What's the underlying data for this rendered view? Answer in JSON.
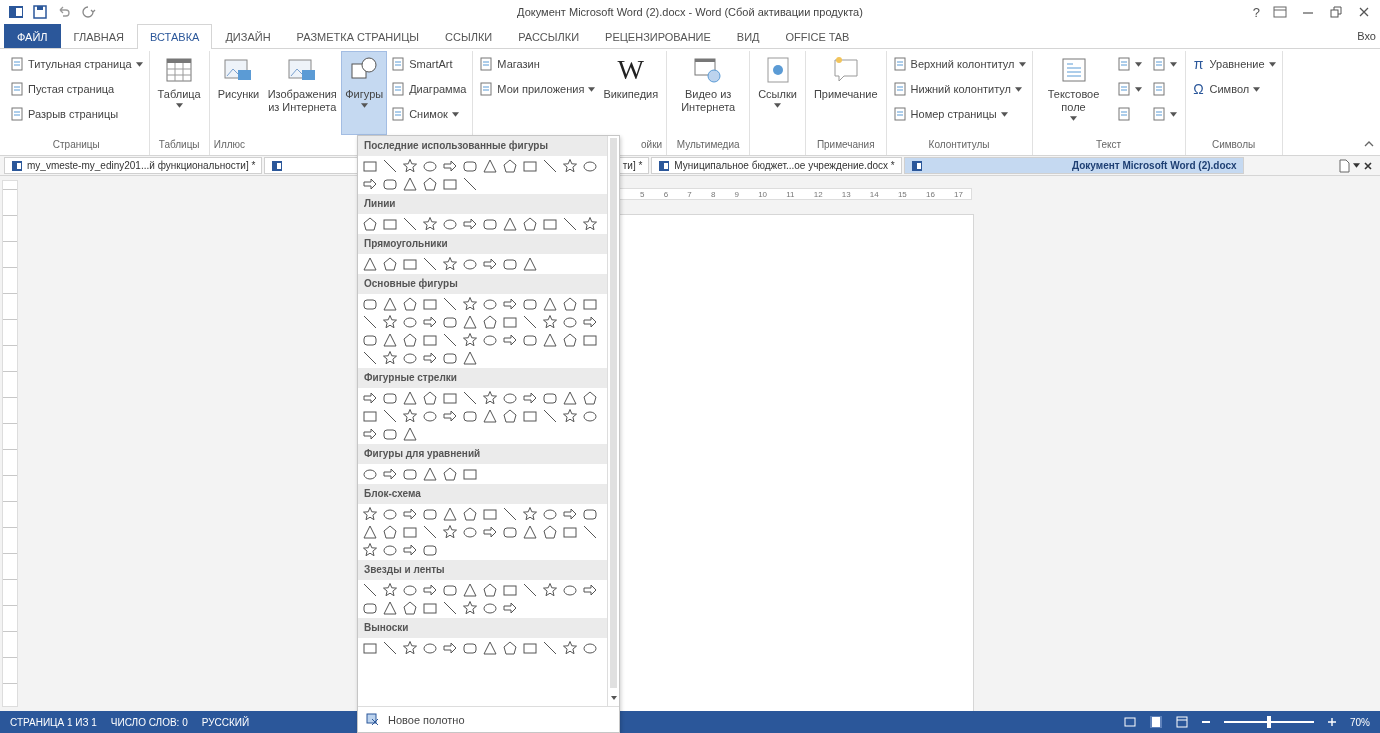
{
  "window": {
    "title": "Документ Microsoft Word (2).docx - Word (Сбой активации продукта)",
    "help": "?"
  },
  "menu_tabs": [
    {
      "label": "ФАЙЛ",
      "kind": "file",
      "selected": false
    },
    {
      "label": "ГЛАВНАЯ",
      "kind": "tab",
      "selected": false
    },
    {
      "label": "ВСТАВКА",
      "kind": "tab",
      "selected": true
    },
    {
      "label": "ДИЗАЙН",
      "kind": "tab",
      "selected": false
    },
    {
      "label": "РАЗМЕТКА СТРАНИЦЫ",
      "kind": "tab",
      "selected": false
    },
    {
      "label": "ССЫЛКИ",
      "kind": "tab",
      "selected": false
    },
    {
      "label": "РАССЫЛКИ",
      "kind": "tab",
      "selected": false
    },
    {
      "label": "РЕЦЕНЗИРОВАНИЕ",
      "kind": "tab",
      "selected": false
    },
    {
      "label": "ВИД",
      "kind": "tab",
      "selected": false
    },
    {
      "label": "OFFICE TAB",
      "kind": "tab",
      "selected": false
    }
  ],
  "sign_in": "Вхо",
  "ribbon": {
    "groups": [
      {
        "label": "Страницы",
        "items": [
          {
            "kind": "small",
            "label": "Титульная страница",
            "dropdown": true
          },
          {
            "kind": "small",
            "label": "Пустая страница"
          },
          {
            "kind": "small",
            "label": "Разрыв страницы"
          }
        ]
      },
      {
        "label": "Таблицы",
        "items": [
          {
            "kind": "large",
            "label": "Таблица",
            "dropdown": true
          }
        ]
      },
      {
        "label": "Иллюс",
        "items": [
          {
            "kind": "large",
            "label": "Рисунки"
          },
          {
            "kind": "large",
            "label": "Изображения из Интернета"
          },
          {
            "kind": "large",
            "label": "Фигуры",
            "dropdown": true,
            "pressed": true
          },
          {
            "kind": "small",
            "label": "SmartArt"
          },
          {
            "kind": "small",
            "label": "Диаграмма"
          },
          {
            "kind": "small",
            "label": "Снимок",
            "dropdown": true
          }
        ]
      },
      {
        "label": "ойки",
        "items": [
          {
            "kind": "small",
            "label": "Магазин"
          },
          {
            "kind": "small",
            "label": "Мои приложения",
            "dropdown": true
          },
          {
            "kind": "large",
            "label": "Википедия",
            "icon_text": "W"
          }
        ]
      },
      {
        "label": "Мультимедиа",
        "items": [
          {
            "kind": "large",
            "label": "Видео из Интернета"
          }
        ]
      },
      {
        "items": [
          {
            "kind": "large",
            "label": "Ссылки",
            "dropdown": true
          }
        ]
      },
      {
        "label": "Примечания",
        "items": [
          {
            "kind": "large",
            "label": "Примечание"
          }
        ]
      },
      {
        "label": "Колонтитулы",
        "items": [
          {
            "kind": "small",
            "label": "Верхний колонтитул",
            "dropdown": true
          },
          {
            "kind": "small",
            "label": "Нижний колонтитул",
            "dropdown": true
          },
          {
            "kind": "small",
            "label": "Номер страницы",
            "dropdown": true
          }
        ]
      },
      {
        "label": "Текст",
        "items": [
          {
            "kind": "large",
            "label": "Текстовое поле",
            "dropdown": true
          },
          {
            "kind": "icon",
            "dropdown": true
          },
          {
            "kind": "icon",
            "dropdown": true
          },
          {
            "kind": "icon",
            "dropdown": false
          },
          {
            "kind": "icon",
            "dropdown": true
          },
          {
            "kind": "icon",
            "dropdown": false
          },
          {
            "kind": "icon",
            "dropdown": true
          }
        ]
      },
      {
        "label": "Символы",
        "items": [
          {
            "kind": "small",
            "label": "Уравнение",
            "icon_text": "π",
            "dropdown": true
          },
          {
            "kind": "small",
            "label": "Символ",
            "icon_text": "Ω",
            "dropdown": true
          }
        ]
      }
    ]
  },
  "doc_tabs": [
    {
      "label": "my_vmeste-my_ediny201...й функциональности] *",
      "selected": false
    },
    {
      "label": "ти] *",
      "selected": false
    },
    {
      "label": "Муниципальное бюджет...ое учреждение.docx *",
      "selected": false
    },
    {
      "label": "Документ Microsoft Word (2).docx",
      "selected": true
    }
  ],
  "ruler": {
    "labels": [
      "5",
      "6",
      "7",
      "8",
      "9",
      "10",
      "11",
      "12",
      "13",
      "14",
      "15",
      "16",
      "17"
    ]
  },
  "shapes_menu": {
    "sections": [
      {
        "title": "Последние использованные фигуры"
      },
      {
        "title": "Линии"
      },
      {
        "title": "Прямоугольники"
      },
      {
        "title": "Основные фигуры"
      },
      {
        "title": "Фигурные стрелки"
      },
      {
        "title": "Фигуры для уравнений"
      },
      {
        "title": "Блок-схема"
      },
      {
        "title": "Звезды и ленты"
      },
      {
        "title": "Выноски"
      }
    ],
    "footer": "Новое полотно"
  },
  "status_bar": {
    "items": [
      "СТРАНИЦА 1 ИЗ 1",
      "ЧИСЛО СЛОВ: 0",
      "РУССКИЙ"
    ],
    "zoom": {
      "level": 0.5,
      "reading": "70%"
    }
  }
}
